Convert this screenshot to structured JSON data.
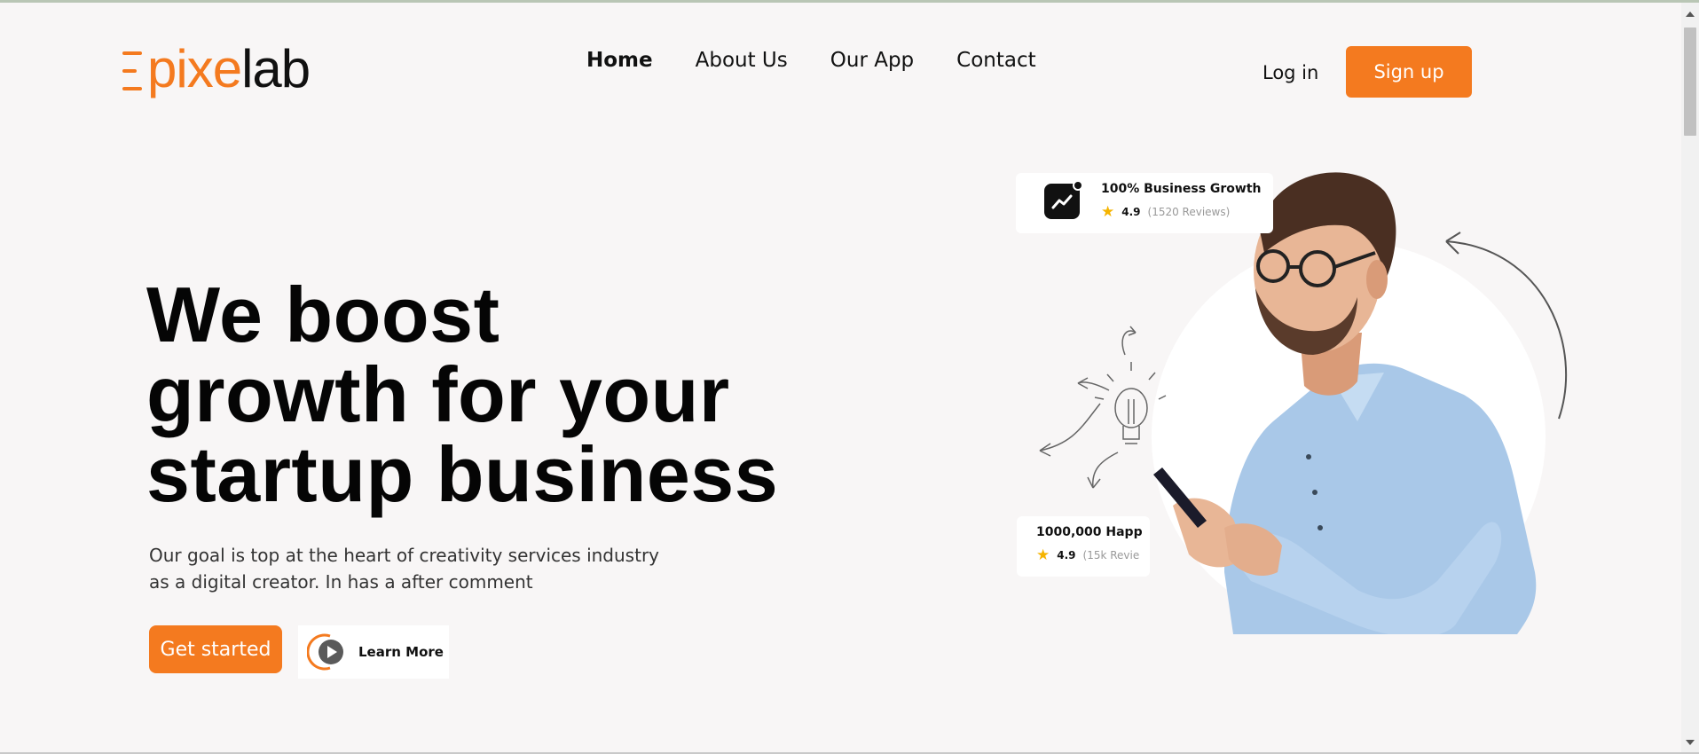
{
  "logo": {
    "prefix": "pixe",
    "suffix": "lab"
  },
  "nav": {
    "items": [
      {
        "label": "Home",
        "active": true
      },
      {
        "label": "About Us",
        "active": false
      },
      {
        "label": "Our App",
        "active": false
      },
      {
        "label": "Contact",
        "active": false
      }
    ]
  },
  "auth": {
    "login_label": "Log in",
    "signup_label": "Sign up"
  },
  "hero": {
    "headline_lines": [
      "We boost",
      "growth for your",
      "startup business"
    ],
    "subtitle_lines": [
      "Our goal is top at the heart of creativity services industry",
      "as a digital creator. In has a after comment"
    ],
    "cta_primary": "Get started",
    "cta_secondary": "Learn More"
  },
  "cards": {
    "growth": {
      "title": "100% Business Growth",
      "rating": "4.9",
      "reviews": "(1520 Reviews)"
    },
    "happy": {
      "title": "1000,000 Happ",
      "rating": "4.9",
      "reviews": "(15k Revie"
    }
  },
  "colors": {
    "accent": "#f47a1f",
    "background": "#f8f6f6"
  },
  "icons": [
    "trend-up-icon",
    "star-icon",
    "play-icon",
    "lightbulb-icon",
    "curved-arrow-icon"
  ]
}
